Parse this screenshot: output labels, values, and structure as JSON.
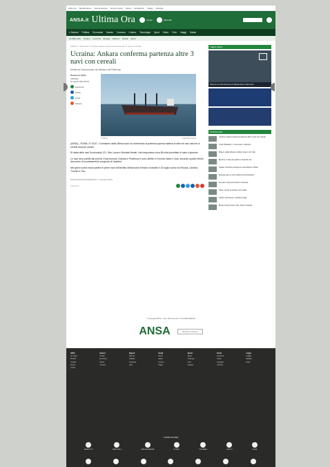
{
  "topbar": [
    "Ultim'ora",
    "Mediterraneo",
    "Nuova Europa",
    "Terra & Gusto",
    "Motori",
    "Eccellenze",
    "Viaggi",
    "Lifestyle"
  ],
  "header": {
    "logo": "ANSA.it",
    "title": "Ultima Ora",
    "btn1": "Accedi",
    "btn2": "Abbonati"
  },
  "nav1": [
    "≡ Sezioni",
    "Politica",
    "Economia",
    "Mondo",
    "Cronaca",
    "Cultura",
    "Tecnologia",
    "Sport",
    "Video",
    "Foto",
    "Viaggi",
    "Salute"
  ],
  "nav2": [
    "ULTIMA ORA",
    "Ucraina",
    "Covid-19",
    "Energia",
    "Elezioni",
    "Siccità",
    "Clima"
  ],
  "breadcrumb": "ANSA.it > Ultima Ora > Ucraina: Ankara conferma partenza altre 3 navi con cereali",
  "headline": "Ucraina: Ankara conferma partenza altre 3 navi con cereali",
  "subhead": "Dirette da Chornomorsk, da Odessa e da Pivdennyi",
  "author": "Redazione ANSA",
  "city": "ANKARA",
  "date": "07 agosto 2022 09:01",
  "share_labels": [
    "Facebook",
    "Twitter",
    "Email",
    "Stampa"
  ],
  "caption_left": "© ANSA",
  "caption_right": "Ingrandisci la foto",
  "body": [
    "(ANSA) - ROMA, 07 AGO - Il ministero della Difesa turco ha confermato la partenza questa mattina di altre tre navi cariche di cereali dai porti ucraini.",
    "Si tratta delle navi Sormovskiy 121, Star Laura e Mustafa Necati, che trasportano circa 58 mila tonnellate di mais e girasole.",
    "Le navi sono partite dai porti di Chornomorsk, Odessa e Pivdennyi e sono dirette in Turchia, Italia e Cina, secondo quanto riferito dal centro di coordinamento congiunto di Istanbul.",
    "Nei giorni scorsi erano partite le prime navi nell'ambito dell'accordo firmato a Istanbul il 22 luglio scorso tra Russia, Ucraina, Turchia e Onu."
  ],
  "meta": "RIPRODUZIONE RISERVATA © Copyright ANSA",
  "aside": {
    "video_title": "VIDEO ANSA",
    "video_caption": "Fiamme sul molo del porto di Odessa dopo il raid russo",
    "list_title": "ULTIMA ORA",
    "items": [
      "Ucraina: Ankara conferma partenza altre 3 navi con cereali",
      "Covid: Bollettino, i nuovi casi e i decessi",
      "Meteo: caldo africano, bollino rosso in 16 città",
      "Elezioni, le liste dei partiti in vista del voto",
      "Taiwan: Pechino prosegue le esercitazioni militari",
      "Energia, gas a nuovi massimi ad Amsterdam",
      "Incendi: in fiamme boschi in Toscana",
      "Gaza, scontri al confine con Israele",
      "Calcio: amichevoli, i risultati di oggi",
      "Borsa: Hong Kong in calo, Tokyo invariata"
    ]
  },
  "footer": {
    "info": "© Copyright ANSA - Tutti i diritti riservati - P.IVA 00876481003",
    "logo": "ANSA",
    "select_label": "Scegli la sezione",
    "columns": [
      {
        "title": "ANSA",
        "items": [
          "Chi siamo",
          "Prodotti",
          "Contatti",
          "Privacy",
          "Cookie"
        ]
      },
      {
        "title": "Sezioni",
        "items": [
          "Politica",
          "Economia",
          "Mondo",
          "Cronaca"
        ]
      },
      {
        "title": "Regioni",
        "items": [
          "Abruzzo",
          "Calabria",
          "Campania",
          "Lazio"
        ]
      },
      {
        "title": "Canali",
        "items": [
          "Motori",
          "Salute",
          "Scienza",
          "Viaggi"
        ]
      },
      {
        "title": "Servizi",
        "items": [
          "Meteo",
          "Oroscopo",
          "Lotto",
          "Podcast"
        ]
      },
      {
        "title": "Social",
        "items": [
          "Facebook",
          "Twitter",
          "Instagram",
          "YouTube"
        ]
      },
      {
        "title": "Lingue",
        "items": [
          "English",
          "Español",
          "Brasil"
        ]
      }
    ],
    "channels_title": "I CANALI DI ANSA",
    "channels": [
      "ANSA FOTO",
      "PIEMONTE &",
      "EMILIA ROMAGNA",
      "ESTERI",
      "TOSCANA &",
      "LAZIO E",
      "ITALIA"
    ]
  }
}
